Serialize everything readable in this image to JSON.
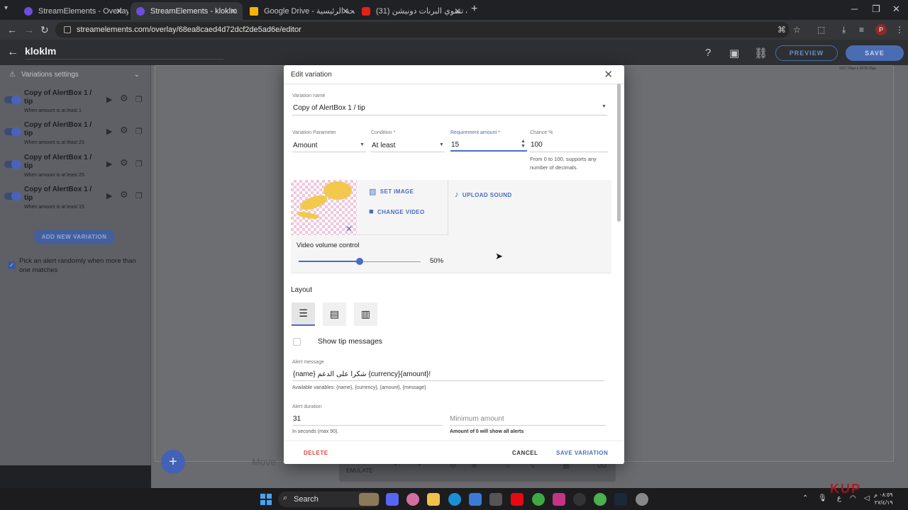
{
  "browser": {
    "tabs": [
      {
        "title": "StreamElements - Overlays",
        "active": false
      },
      {
        "title": "StreamElements - kloklm",
        "active": true
      },
      {
        "title": "Google Drive - الصفحة الرئيسية",
        "active": false
      },
      {
        "title": "(31) كيف تسوي البرنات دونيشن -",
        "active": false
      }
    ],
    "url": "streamelements.com/overlay/68ea8caed4d72dcf2de5ad6e/editor"
  },
  "header": {
    "overlay_name": "kloklm",
    "preview_label": "PREVIEW",
    "save_label": "SAVE"
  },
  "sidebar": {
    "section_title": "Variations settings",
    "variations": [
      {
        "title": "Copy of AlertBox 1 / tip",
        "subtitle": "When amount is at least 1"
      },
      {
        "title": "Copy of AlertBox 1 / tip",
        "subtitle": "When amount is at least 25"
      },
      {
        "title": "Copy of AlertBox 1 / tip",
        "subtitle": "When amount is at least 25"
      },
      {
        "title": "Copy of AlertBox 1 / tip",
        "subtitle": "When amount is at least 15"
      }
    ],
    "add_variation_label": "ADD NEW VARIATION",
    "random_label": "Pick an alert randomly when more than one matches",
    "random_checked": true
  },
  "canvas": {
    "resolution": "1517.25px x 1078.75px",
    "move_hint": "Move",
    "emulate_label": "EMULATE"
  },
  "modal": {
    "title": "Edit variation",
    "variation_name_label": "Variation name",
    "variation_name_value": "Copy of AlertBox 1 / tip",
    "parameter_label": "Variation Parameter",
    "parameter_value": "Amount",
    "condition_label": "Condition *",
    "condition_value": "At least",
    "requirement_label": "Requirement amount *",
    "requirement_value": "15",
    "chance_label": "Chance %",
    "chance_value": "100",
    "chance_help": "From 0 to 100, supports any number of decimals.",
    "set_image_label": "SET IMAGE",
    "change_video_label": "CHANGE VIDEO",
    "upload_sound_label": "UPLOAD SOUND",
    "volume_label": "Video volume control",
    "volume_value": "50%",
    "volume_fraction": 0.5,
    "layout_title": "Layout",
    "show_tip_label": "Show tip messages",
    "alert_message_label": "Alert message",
    "alert_message_value": "{name} شكرا على الدعم {currency}{amount}!",
    "available_variables": "Available variables: {name}, {currency}, {amount}, {message}",
    "alert_duration_label": "Alert duration",
    "alert_duration_value": "31",
    "alert_duration_help": "In seconds (max 90).",
    "minimum_amount_placeholder": "Minimum amount",
    "minimum_amount_help": "Amount of 0 will show all alerts",
    "delete_label": "DELETE",
    "cancel_label": "CANCEL",
    "save_variation_label": "SAVE VARIATION"
  },
  "taskbar": {
    "search_label": "Search",
    "clock_time": "٠٨:٥٩ م",
    "clock_date": "٢٧/٤/١٩",
    "lang": "ع"
  },
  "watermark": "KUP",
  "colors": {
    "accent": "#4a6cc4",
    "delete": "#e0443e"
  }
}
